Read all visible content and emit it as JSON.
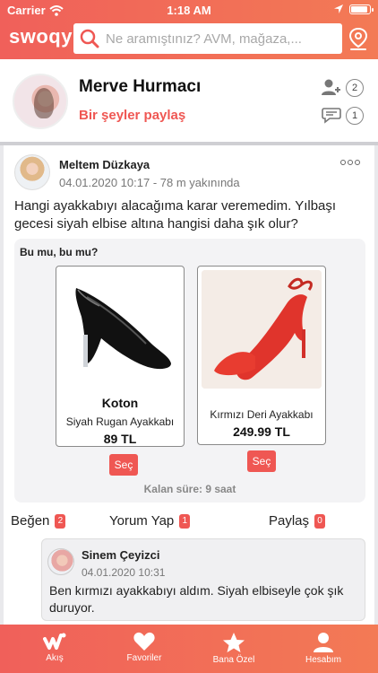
{
  "status_bar": {
    "carrier": "Carrier",
    "time": "1:18 AM"
  },
  "header": {
    "brand": "swoqy",
    "search_placeholder": "Ne aramıştınız? AVM, mağaza,..."
  },
  "profile": {
    "name": "Merve Hurmacı",
    "share_label": "Bir şeyler paylaş",
    "friend_requests": "2",
    "messages": "1"
  },
  "post": {
    "author": "Meltem Düzkaya",
    "meta": "04.01.2020 10:17 - 78 m yakınında",
    "text": "Hangi ayakkabıyı alacağıma karar veremedim. Yılbaşı gecesi siyah elbise altına hangisi daha şık olur?",
    "poll": {
      "title": "Bu mu, bu mu?",
      "options": [
        {
          "brand": "Koton",
          "name": "Siyah Rugan Ayakkabı",
          "price": "89 TL",
          "select_label": "Seç",
          "color": "#111111"
        },
        {
          "brand": "",
          "name": "Kırmızı Deri Ayakkabı",
          "price": "249.99 TL",
          "select_label": "Seç",
          "color": "#e0342c"
        }
      ],
      "remaining": "Kalan süre: 9 saat"
    },
    "actions": {
      "like_label": "Beğen",
      "like_count": "2",
      "comment_label": "Yorum Yap",
      "comment_count": "1",
      "share_label": "Paylaş",
      "share_count": "0"
    },
    "comment": {
      "author": "Sinem Çeyizci",
      "date": "04.01.2020 10:31",
      "text": "Ben kırmızı ayakkabıyı aldım. Siyah elbiseyle çok şık duruyor."
    }
  },
  "tabs": [
    {
      "label": "Akış",
      "icon": "wave-icon"
    },
    {
      "label": "Favoriler",
      "icon": "heart-icon"
    },
    {
      "label": "Bana Özel",
      "icon": "star-icon"
    },
    {
      "label": "Hesabım",
      "icon": "user-icon"
    }
  ],
  "colors": {
    "accent": "#ef5753",
    "gradient_end": "#f37a55"
  }
}
